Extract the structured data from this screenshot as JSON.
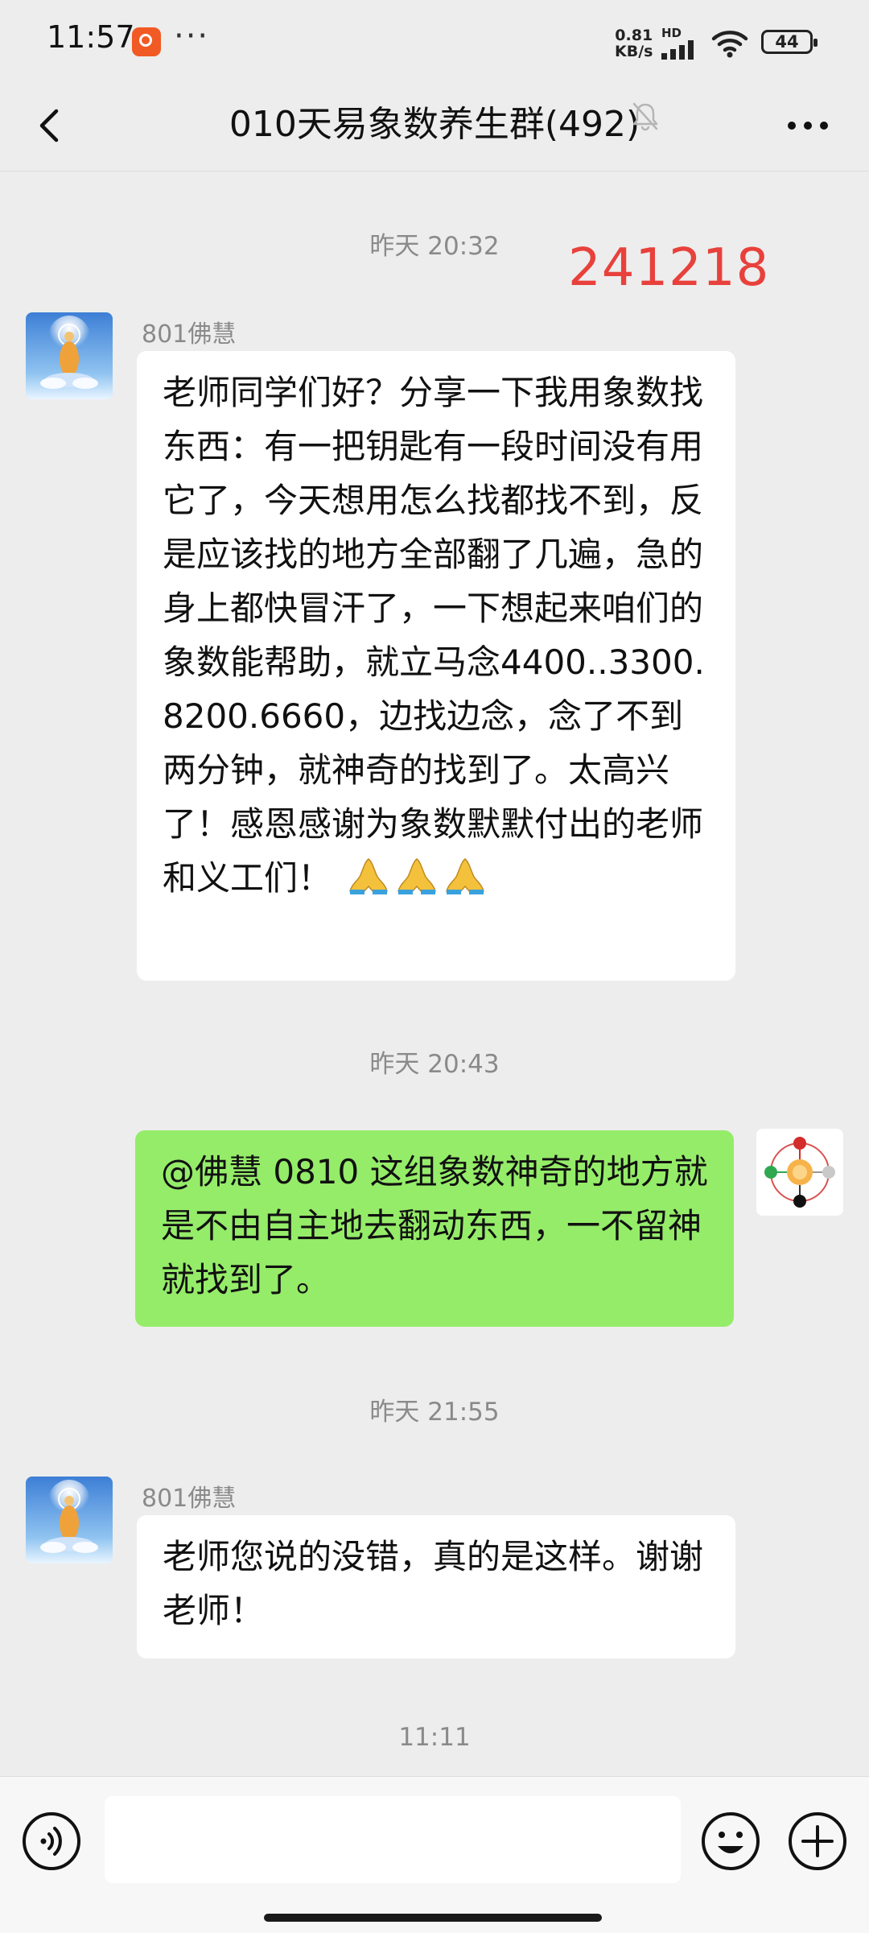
{
  "status_bar": {
    "time": "11:57",
    "more": "···",
    "net_speed_value": "0.81",
    "net_speed_unit": "KB/s",
    "hd": "HD",
    "battery": "44"
  },
  "header": {
    "title": "010天易象数养生群(492)"
  },
  "overlay_number": "241218",
  "messages": [
    {
      "timestamp": "昨天 20:32",
      "sender": "801佛慧",
      "text": "老师同学们好？分享一下我用象数找东西：有一把钥匙有一段时间没有用它了，今天想用怎么找都找不到，反是应该找的地方全部翻了几遍，急的身上都快冒汗了，一下想起来咱们的象数能帮助，就立马念4400..3300.8200.6660，边找边念，念了不到两分钟，就神奇的找到了。太高兴了！感恩感谢为象数默默付出的老师和义工们！"
    },
    {
      "timestamp": "昨天 20:43",
      "text": "@佛慧 0810  这组象数神奇的地方就是不由自主地去翻动东西，一不留神就找到了。"
    },
    {
      "timestamp": "昨天 21:55",
      "sender": "801佛慧",
      "text": "老师您说的没错，真的是这样。谢谢老师！"
    }
  ],
  "last_timestamp": "11:11",
  "colors": {
    "background": "#ededed",
    "incoming_bubble": "#ffffff",
    "outgoing_bubble": "#95ec69",
    "overlay_number": "#e8413c"
  }
}
